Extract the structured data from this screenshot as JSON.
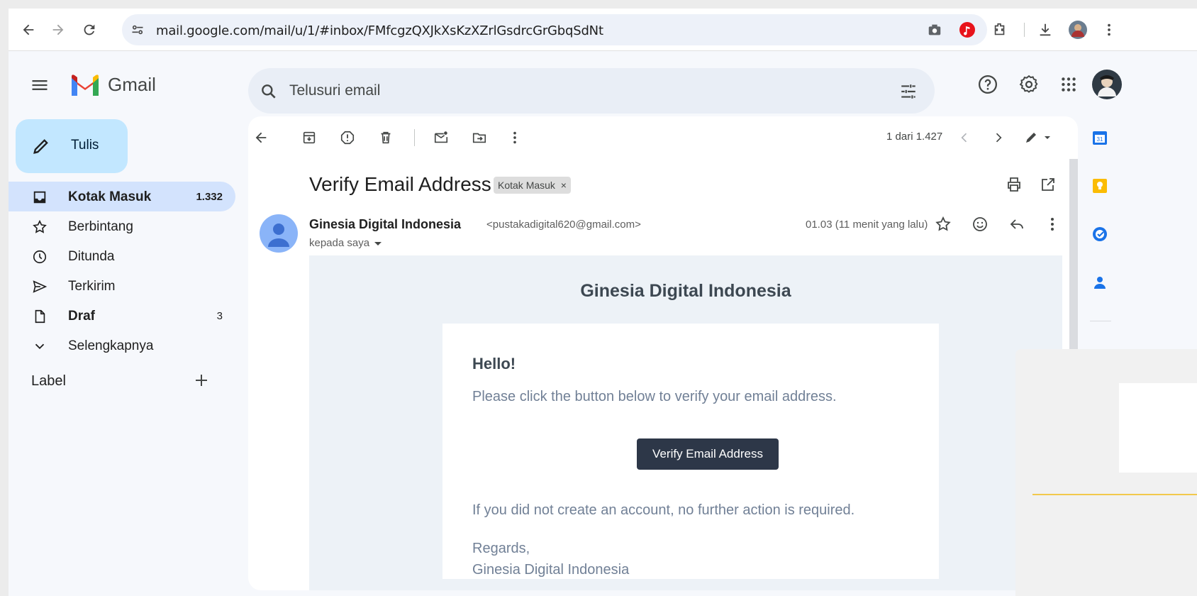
{
  "browser": {
    "url": "mail.google.com/mail/u/1/#inbox/FMfcgzQXJkXsKzXZrlGsdrcGrGbqSdNt"
  },
  "app": {
    "name": "Gmail"
  },
  "search": {
    "placeholder": "Telusuri email"
  },
  "compose": {
    "label": "Tulis"
  },
  "nav": {
    "items": [
      {
        "label": "Kotak Masuk",
        "count": "1.332"
      },
      {
        "label": "Berbintang",
        "count": ""
      },
      {
        "label": "Ditunda",
        "count": ""
      },
      {
        "label": "Terkirim",
        "count": ""
      },
      {
        "label": "Draf",
        "count": "3"
      },
      {
        "label": "Selengkapnya",
        "count": ""
      }
    ]
  },
  "labels": {
    "title": "Label"
  },
  "toolbar": {
    "pagination": "1 dari 1.427"
  },
  "message": {
    "subject": "Verify Email Address",
    "tag": "Kotak Masuk",
    "sender_name": "Ginesia Digital Indonesia",
    "sender_email": "<pustakadigital620@gmail.com>",
    "recipient": "kepada saya",
    "time": "01.03 (11 menit yang lalu)"
  },
  "email_body": {
    "brand": "Ginesia Digital Indonesia",
    "greeting": "Hello!",
    "intro": "Please click the button below to verify your email address.",
    "button": "Verify Email Address",
    "outro": "If you did not create an account, no further action is required.",
    "regards": "Regards,",
    "signature": "Ginesia Digital Indonesia"
  },
  "colors": {
    "accent": "#0b57d0",
    "compose_bg": "#c2e7ff",
    "active_nav": "#d3e3fd",
    "verify_button": "#2d3748"
  }
}
